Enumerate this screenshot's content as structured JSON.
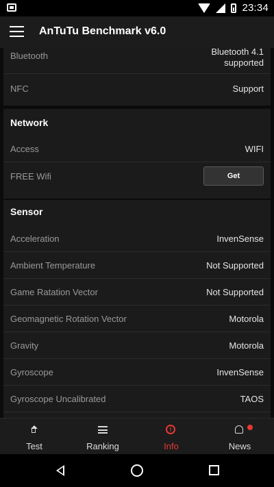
{
  "status_bar": {
    "time": "23:34"
  },
  "app_bar": {
    "title": "AnTuTu Benchmark v6.0"
  },
  "top_rows": [
    {
      "label": "Bluetooth",
      "value_line1": "Bluetooth 4.1",
      "value_line2": "supported"
    },
    {
      "label": "NFC",
      "value": "Support"
    }
  ],
  "network": {
    "title": "Network",
    "access_label": "Access",
    "access_value": "WIFI",
    "freewifi_label": "FREE Wifi",
    "get_button": "Get"
  },
  "sensor": {
    "title": "Sensor",
    "rows": [
      {
        "label": "Acceleration",
        "value": "InvenSense"
      },
      {
        "label": "Ambient Temperature",
        "value": "Not Supported"
      },
      {
        "label": "Game Ratation Vector",
        "value": "Not Supported"
      },
      {
        "label": "Geomagnetic Rotation Vector",
        "value": "Motorola"
      },
      {
        "label": "Gravity",
        "value": "Motorola"
      },
      {
        "label": "Gyroscope",
        "value": "InvenSense"
      },
      {
        "label": "Gyroscope Uncalibrated",
        "value": "TAOS"
      }
    ]
  },
  "bottom_nav": {
    "items": [
      {
        "label": "Test",
        "icon": "home-icon"
      },
      {
        "label": "Ranking",
        "icon": "list-icon"
      },
      {
        "label": "Info",
        "icon": "info-icon",
        "active": true
      },
      {
        "label": "News",
        "icon": "bell-icon"
      }
    ],
    "active_color": "#e53935"
  }
}
